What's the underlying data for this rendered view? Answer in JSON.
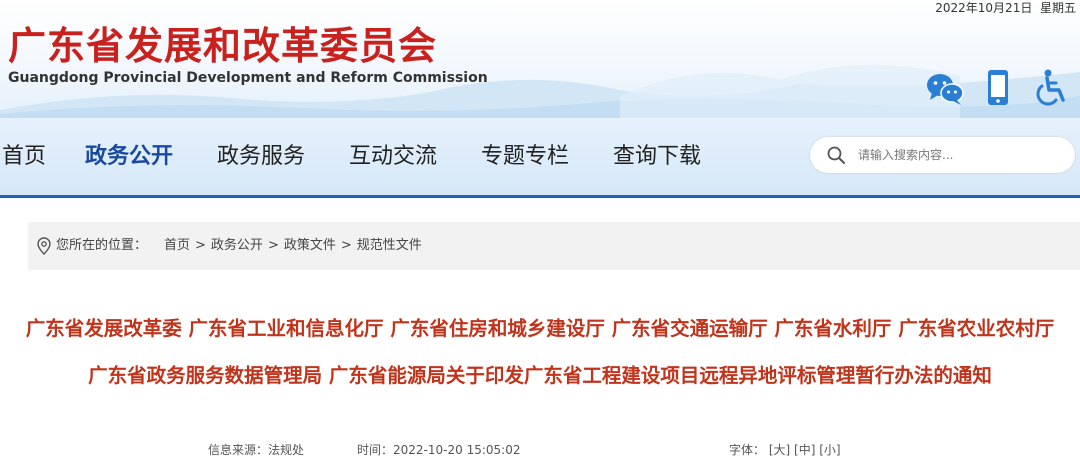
{
  "header": {
    "date": "2022年10月21日",
    "weekday": "星期五",
    "title": "广东省发展和改革委员会",
    "subtitle": "Guangdong Provincial Development and Reform Commission",
    "icons": [
      "wechat-icon",
      "mobile-icon",
      "accessibility-icon"
    ]
  },
  "nav": {
    "items": [
      "首页",
      "政务公开",
      "政务服务",
      "互动交流",
      "专题专栏",
      "查询下载"
    ],
    "active": "政务公开",
    "search_placeholder": "请输入搜索内容..."
  },
  "breadcrumb": {
    "label": "您所在的位置：",
    "items": [
      "首页",
      "政务公开",
      "政策文件",
      "规范性文件"
    ],
    "separator": ">"
  },
  "article": {
    "title": "广东省发展改革委 广东省工业和信息化厅 广东省住房和城乡建设厅 广东省交通运输厅 广东省水利厅 广东省农业农村厅 广东省政务服务数据管理局 广东省能源局关于印发广东省工程建设项目远程异地评标管理暂行办法的通知",
    "source_label": "信息来源：",
    "source": "法规处",
    "time_label": "时间：",
    "time": "2022-10-20 15:05:02",
    "font_label": "字体：",
    "font_sizes": [
      "[大]",
      "[中]",
      "[小]"
    ]
  },
  "colors": {
    "brand_red": "#c9211e",
    "title_red": "#c0341c",
    "nav_active": "#1a4aa0",
    "nav_border": "#1f63b8",
    "icon_blue": "#2a7fd4"
  }
}
